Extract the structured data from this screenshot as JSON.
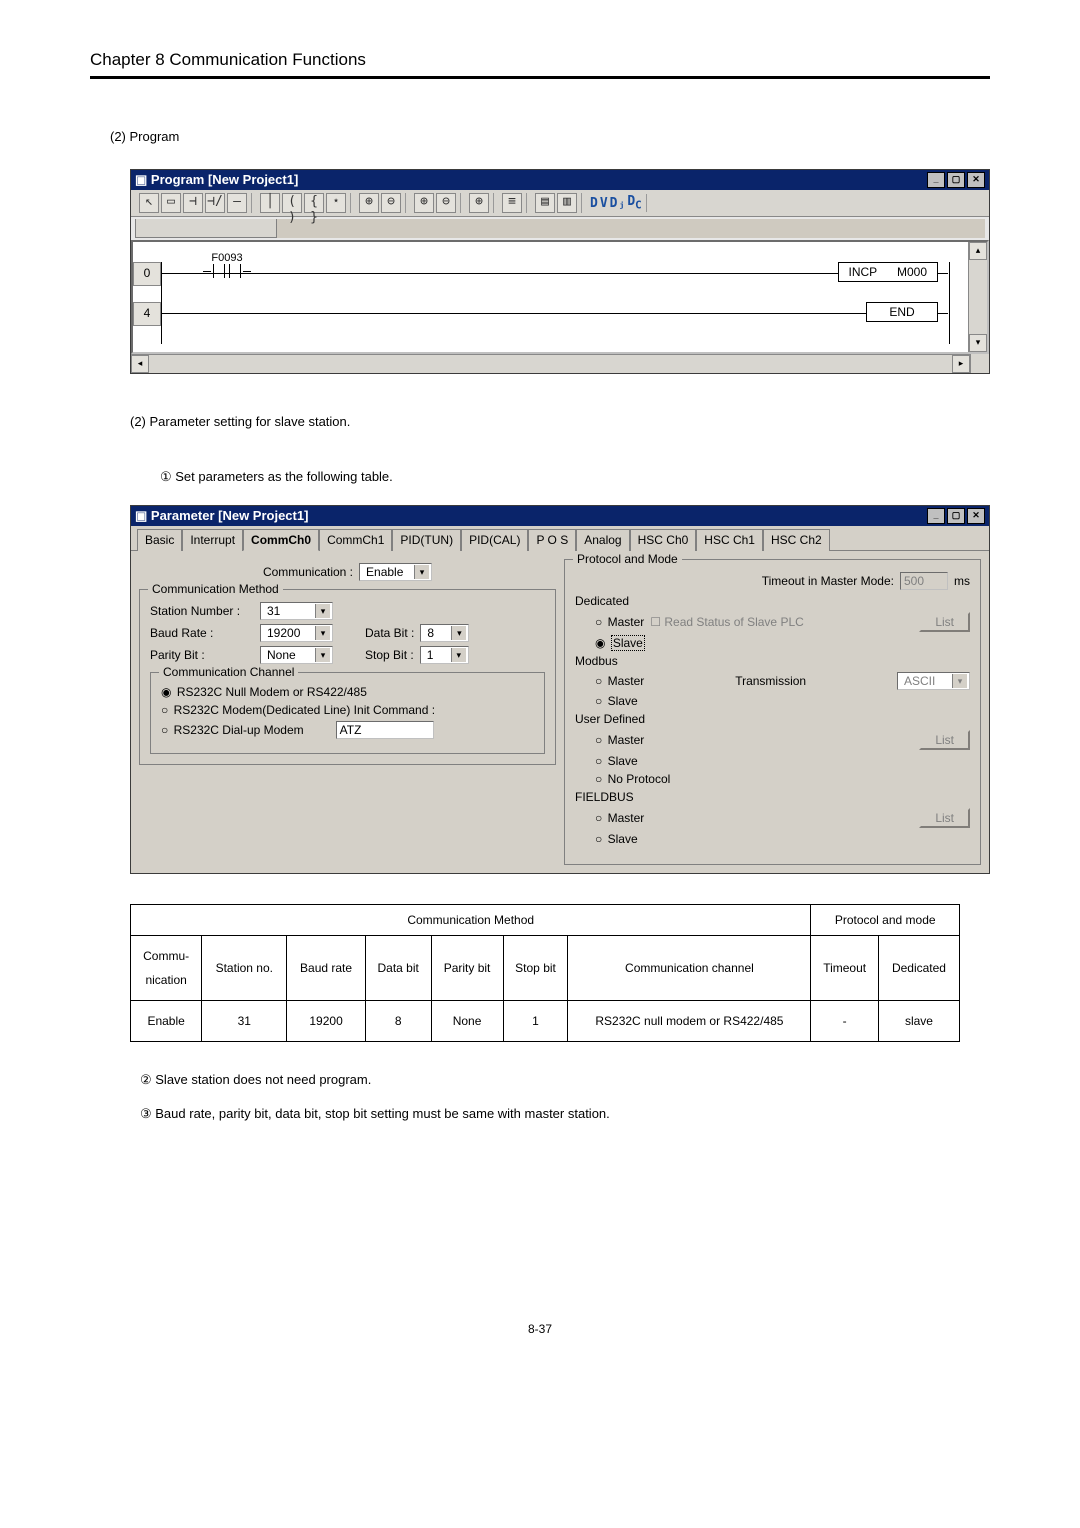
{
  "header": {
    "chapter": "Chapter 8   Communication Functions"
  },
  "sections": {
    "s2": "(2) Program",
    "s2b": "(2)    Parameter setting for slave station.",
    "s_step1": "①  Set parameters as the following table.",
    "note2": "②  Slave station does not need program.",
    "note3": "③  Baud rate, parity bit, data bit, stop bit setting must be same with master station."
  },
  "program_window": {
    "title": "Program [New Project1]",
    "toolbar_glyphs": [
      "↖",
      "▭",
      "⊣⊢",
      "⊣/⊢",
      "—",
      "│",
      "( )",
      "{ }",
      "⋆",
      " ",
      "⊕",
      "⊖",
      " ",
      "⊕",
      "⊖",
      " ",
      "⊕",
      " ",
      "≡",
      " ",
      "▤",
      "▥",
      " ",
      "D",
      "V",
      "Dⱼ",
      "Dc"
    ],
    "rungs": [
      {
        "no": "0",
        "contact": "F0093",
        "coil": "INCP",
        "dest": "M000"
      },
      {
        "no": "4",
        "coil": "END"
      }
    ]
  },
  "param_window": {
    "title": "Parameter [New Project1]",
    "tabs": [
      "Basic",
      "Interrupt",
      "CommCh0",
      "CommCh1",
      "PID(TUN)",
      "PID(CAL)",
      "P O S",
      "Analog",
      "HSC Ch0",
      "HSC Ch1",
      "HSC Ch2"
    ],
    "active_tab_index": 2,
    "left": {
      "communication_label": "Communication :",
      "communication_value": "Enable",
      "method_legend": "Communication Method",
      "station_label": "Station Number :",
      "station_value": "31",
      "baud_label": "Baud Rate :",
      "baud_value": "19200",
      "data_label": "Data Bit :",
      "data_value": "8",
      "parity_label": "Parity Bit :",
      "parity_value": "None",
      "stop_label": "Stop Bit :",
      "stop_value": "1",
      "channel_legend": "Communication Channel",
      "opt1": "RS232C Null Modem or RS422/485",
      "opt2": "RS232C Modem(Dedicated Line)   Init Command :",
      "opt3": "RS232C Dial-up Modem",
      "init_cmd": "ATZ"
    },
    "right": {
      "legend": "Protocol and Mode",
      "timeout_label": "Timeout in Master Mode:",
      "timeout_value": "500",
      "timeout_unit": "ms",
      "dedicated": "Dedicated",
      "master": "Master",
      "read_status": "Read Status of Slave PLC",
      "slave": "Slave",
      "modbus": "Modbus",
      "transmission": "Transmission",
      "ascii": "ASCII",
      "user_defined": "User Defined",
      "no_protocol": "No Protocol",
      "fieldbus": "FIELDBUS",
      "list": "List"
    }
  },
  "table": {
    "headers": {
      "method": "Communication Method",
      "protocol": "Protocol and mode",
      "cols": [
        "Commu-\nnication",
        "Station no.",
        "Baud rate",
        "Data bit",
        "Parity bit",
        "Stop bit",
        "Communication channel",
        "Timeout",
        "Dedicated"
      ]
    },
    "row": {
      "comm": "Enable",
      "station": "31",
      "baud": "19200",
      "databit": "8",
      "parity": "None",
      "stopbit": "1",
      "channel": "RS232C null modem or RS422/485",
      "timeout": "-",
      "dedicated": "slave"
    }
  },
  "footer": "8-37"
}
